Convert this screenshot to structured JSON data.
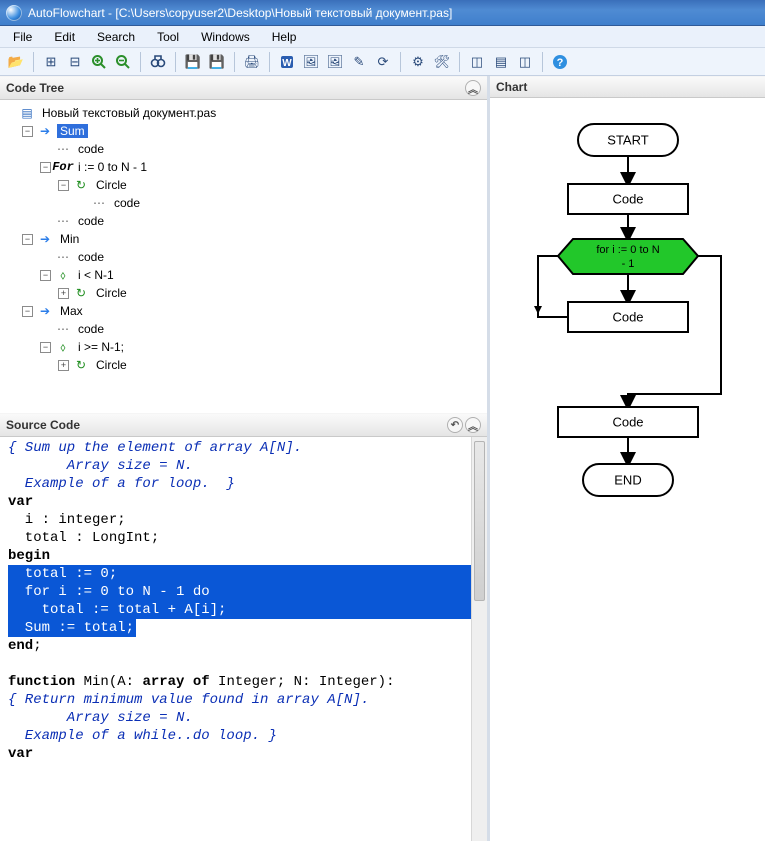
{
  "window": {
    "title": "AutoFlowchart - [C:\\Users\\copyuser2\\Desktop\\Новый текстовый документ.pas]"
  },
  "menus": [
    "File",
    "Edit",
    "Search",
    "Tool",
    "Windows",
    "Help"
  ],
  "toolbar": {
    "groups": [
      [
        {
          "name": "open-icon",
          "label": "📂",
          "tip": "Open"
        }
      ],
      [
        {
          "name": "expand-icon",
          "label": "⊞",
          "tip": "Expand"
        },
        {
          "name": "collapse-icon",
          "label": "⊟",
          "tip": "Collapse"
        },
        {
          "name": "zoom-in-icon",
          "label": "🔍+",
          "tip": "Zoom In",
          "svg": "zoom-in"
        },
        {
          "name": "zoom-out-icon",
          "label": "🔍-",
          "tip": "Zoom Out",
          "svg": "zoom-out"
        }
      ],
      [
        {
          "name": "find-icon",
          "label": "🔎",
          "tip": "Find",
          "svg": "binoc"
        }
      ],
      [
        {
          "name": "save-icon",
          "label": "💾",
          "tip": "Save"
        },
        {
          "name": "save-as-icon",
          "label": "💾",
          "tip": "Save As"
        }
      ],
      [
        {
          "name": "print-icon",
          "label": "🖨",
          "tip": "Print"
        }
      ],
      [
        {
          "name": "export-word-icon",
          "label": "W",
          "tip": "Export Word",
          "svg": "doc-w"
        },
        {
          "name": "export-bmp-icon",
          "label": "🖼",
          "tip": "Export BMP"
        },
        {
          "name": "export-svg-icon",
          "label": "🖼",
          "tip": "Export SVG"
        },
        {
          "name": "settings-chart-icon",
          "label": "✎",
          "tip": "Chart Settings"
        },
        {
          "name": "refresh-icon",
          "label": "⟳",
          "tip": "Refresh"
        }
      ],
      [
        {
          "name": "tool-config-icon",
          "label": "⚙",
          "tip": "Configure"
        },
        {
          "name": "tool-options-icon",
          "label": "🛠",
          "tip": "Options"
        }
      ],
      [
        {
          "name": "layout-tree-icon",
          "label": "◫",
          "tip": "Tree"
        },
        {
          "name": "layout-code-icon",
          "label": "▤",
          "tip": "Code"
        },
        {
          "name": "layout-chart-icon",
          "label": "◫",
          "tip": "Chart"
        }
      ],
      [
        {
          "name": "help-icon",
          "label": "?",
          "tip": "Help",
          "svg": "help"
        }
      ]
    ]
  },
  "panels": {
    "codeTree": "Code Tree",
    "sourceCode": "Source Code",
    "chart": "Chart"
  },
  "tree": {
    "root": "Новый текстовый документ.pas",
    "nodes": {
      "sum": "Sum",
      "code": "code",
      "forLabel": "i := 0 to N - 1",
      "circle": "Circle",
      "min": "Min",
      "iLtN1": "i < N-1",
      "max": "Max",
      "iGeN1": "i >= N-1;"
    }
  },
  "source": {
    "l1": "{ Sum up the element of array A[N].",
    "l2": "       Array size = N.",
    "l3": "  Example of a for loop.  }",
    "l4a": "var",
    "l5": "  i : integer;",
    "l6": "  total : LongInt;",
    "l7a": "begin",
    "hl1": "  total := 0;",
    "hl2": "  for i := 0 to N - 1 do",
    "hl3": "    total := total + A[i];",
    "hl4": "",
    "hl5": "  Sum := total;",
    "l12a": "end",
    "l12b": ";",
    "l13": "",
    "l14a": "function",
    "l14b": " Min(A: ",
    "l14c": "array of",
    "l14d": " Integer; N: Integer):",
    "l15": "{ Return minimum value found in array A[N].",
    "l16": "       Array size = N.",
    "l17": "  Example of a while..do loop. }",
    "l18a": "var"
  },
  "flow": {
    "start": "START",
    "code1": "Code",
    "loop1": "for i := 0 to N",
    "loop2": "- 1",
    "body": "Code",
    "after": "Code",
    "end": "END"
  }
}
